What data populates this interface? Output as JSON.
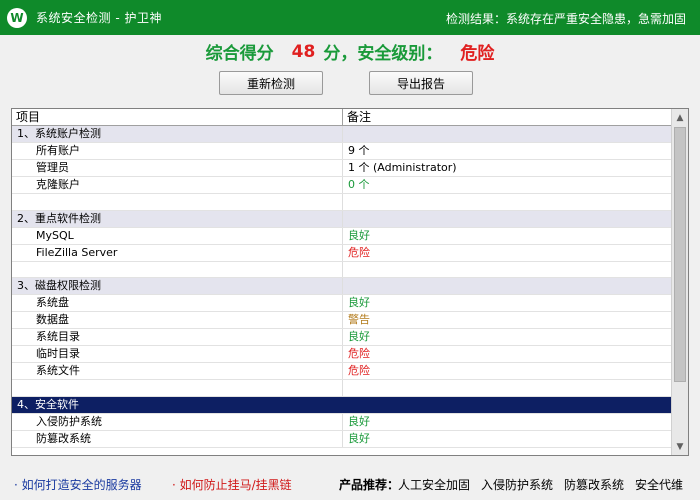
{
  "titlebar": {
    "logo_letter": "W",
    "title": "系统安全检测 - 护卫神",
    "result": "检测结果：系统存在严重安全隐患，急需加固"
  },
  "score": {
    "label": "综合得分",
    "value": "48",
    "unit_level": "分，安全级别：",
    "level": "危险"
  },
  "buttons": {
    "redetect": "重新检测",
    "export": "导出报告"
  },
  "grid": {
    "headers": {
      "item": "项目",
      "note": "备注"
    },
    "rows": [
      {
        "item": "1、系统账户检测",
        "note": ""
      },
      {
        "item": "所有账户",
        "note": "9 个"
      },
      {
        "item": "管理员",
        "note": "1 个 (Administrator)"
      },
      {
        "item": "克隆账户",
        "note": "0 个"
      },
      {
        "item": "",
        "note": ""
      },
      {
        "item": "2、重点软件检测",
        "note": ""
      },
      {
        "item": "MySQL",
        "note": "良好"
      },
      {
        "item": "FileZilla Server",
        "note": "危险"
      },
      {
        "item": "",
        "note": ""
      },
      {
        "item": "3、磁盘权限检测",
        "note": ""
      },
      {
        "item": "系统盘",
        "note": "良好"
      },
      {
        "item": "数据盘",
        "note": "警告"
      },
      {
        "item": "系统目录",
        "note": "良好"
      },
      {
        "item": "临时目录",
        "note": "危险"
      },
      {
        "item": "系统文件",
        "note": "危险"
      },
      {
        "item": "",
        "note": ""
      },
      {
        "item": "4、安全软件",
        "note": ""
      },
      {
        "item": "入侵防护系统",
        "note": "良好"
      },
      {
        "item": "防篡改系统",
        "note": "良好"
      }
    ]
  },
  "footer": {
    "link1": "· 如何打造安全的服务器",
    "link2": "· 如何防止挂马/挂黑链",
    "recommend_label": "产品推荐：",
    "recommends": [
      "人工安全加固",
      "入侵防护系统",
      "防篡改系统",
      "安全代维"
    ]
  },
  "colors": {
    "titlebar": "#0f8a2a",
    "good": "#1a9a3a",
    "danger": "#e02020",
    "warning": "#b27a1a",
    "selected_row": "#0d1f63",
    "category_row": "#e4e4ee"
  }
}
